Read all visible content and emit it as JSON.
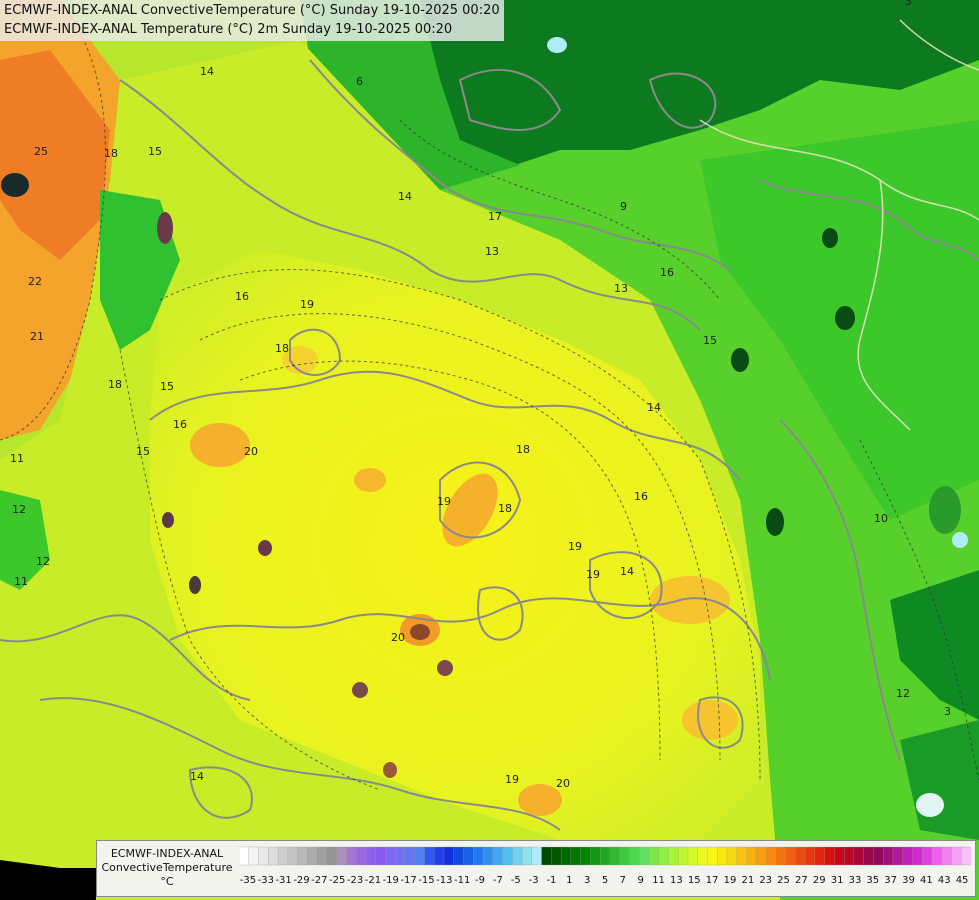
{
  "title_lines": [
    "ECMWF-INDEX-ANAL ConvectiveTemperature (°C) Sunday 19-10-2025 00:20",
    "ECMWF-INDEX-ANAL Temperature (°C) 2m Sunday 19-10-2025 00:20"
  ],
  "legend": {
    "lines": [
      "ECMWF-INDEX-ANAL",
      "ConvectiveTemperature",
      "°C"
    ],
    "ticks": [
      "-35",
      "-33",
      "-31",
      "-29",
      "-27",
      "-25",
      "-23",
      "-21",
      "-19",
      "-17",
      "-15",
      "-13",
      "-11",
      "-9",
      "-7",
      "-5",
      "-3",
      "-1",
      "1",
      "3",
      "5",
      "7",
      "9",
      "11",
      "13",
      "15",
      "17",
      "19",
      "21",
      "23",
      "25",
      "27",
      "29",
      "31",
      "33",
      "35",
      "37",
      "39",
      "41",
      "43",
      "45"
    ],
    "colors": [
      "#ffffff",
      "#f4f4f4",
      "#e8e8e8",
      "#dcdcdc",
      "#d0d0d0",
      "#c4c4c4",
      "#b8b8b8",
      "#acacac",
      "#a0a0a0",
      "#949494",
      "#a890b8",
      "#a078d0",
      "#9868e0",
      "#9060e8",
      "#8858f0",
      "#8068f0",
      "#7070f0",
      "#6078f0",
      "#5080f0",
      "#3058f0",
      "#2040e8",
      "#1030e0",
      "#1048e0",
      "#1860e8",
      "#2078f0",
      "#3090f0",
      "#40a8f0",
      "#50c0f0",
      "#70d0f0",
      "#90e0f0",
      "#b0ecf8",
      "#004800",
      "#005800",
      "#006800",
      "#007800",
      "#008800",
      "#109810",
      "#20a820",
      "#30b830",
      "#40c840",
      "#50d850",
      "#60e060",
      "#78e848",
      "#90f040",
      "#a8f438",
      "#c0f830",
      "#d8f828",
      "#eafa20",
      "#f8f818",
      "#f8e810",
      "#f8d810",
      "#f8c410",
      "#f8b010",
      "#f89c10",
      "#f88810",
      "#f07410",
      "#f06010",
      "#e84c10",
      "#e83810",
      "#e02410",
      "#d81010",
      "#c80818",
      "#b80828",
      "#a80838",
      "#980848",
      "#900858",
      "#a01078",
      "#b01898",
      "#c020b8",
      "#d028d0",
      "#e040e0",
      "#ec60ec",
      "#f080f0",
      "#f4a0f4",
      "#f8c0f8"
    ]
  },
  "contour_labels": [
    "14",
    "15",
    "14",
    "16",
    "18",
    "19",
    "18",
    "18",
    "19",
    "16",
    "16",
    "19",
    "20",
    "20",
    "19",
    "20",
    "18",
    "14",
    "15",
    "16",
    "13",
    "14",
    "15",
    "13",
    "12",
    "12",
    "9",
    "6",
    "10",
    "11",
    "3",
    "3",
    "22",
    "21",
    "25",
    "18",
    "17",
    "15",
    "14",
    "11",
    "12",
    "19"
  ],
  "colors": {
    "yellow": "#f2f520",
    "lime": "#c6ec2a",
    "green": "#5fd42a",
    "dark_green": "#0c7a1e",
    "orange": "#f5a42a",
    "deep_orange": "#ee7d26",
    "contour_grey": "#8a8a8a",
    "border_beige": "#e8e0c0"
  }
}
